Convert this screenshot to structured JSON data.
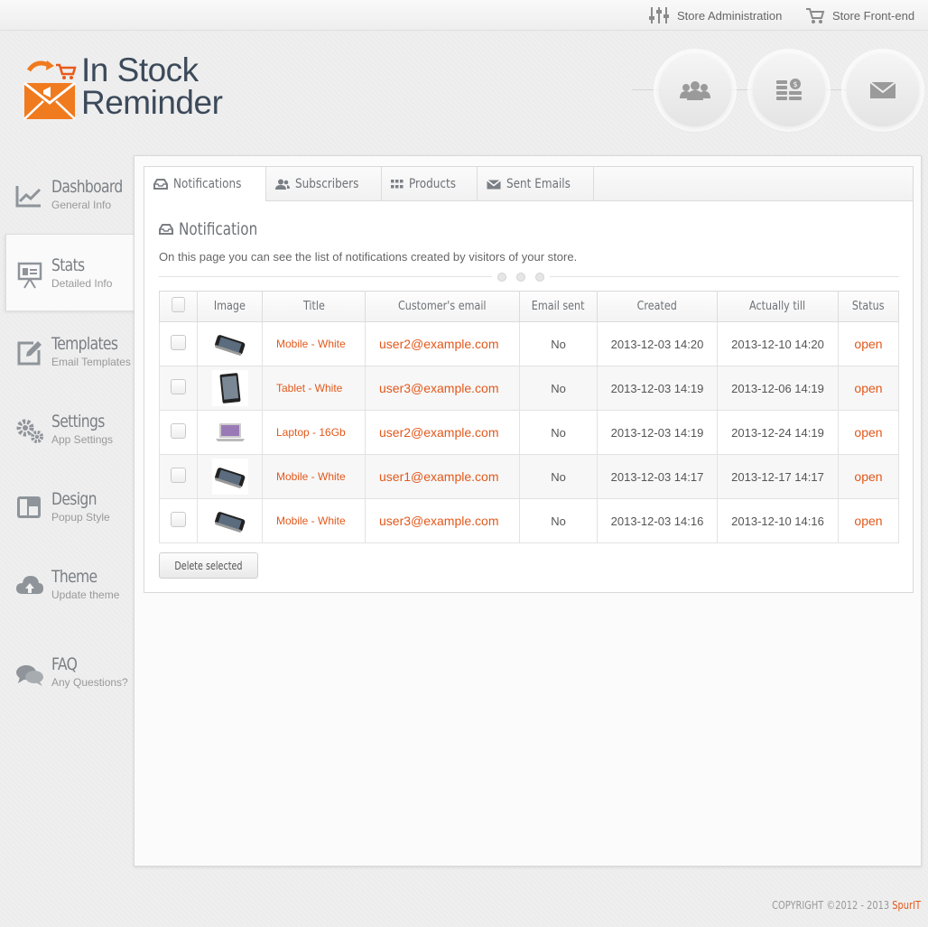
{
  "topbar": {
    "store_admin": "Store Administration",
    "store_front": "Store Front-end"
  },
  "logo": {
    "line1": "In Stock",
    "line2": "Reminder"
  },
  "header_buttons": [
    {
      "icon": "users-icon"
    },
    {
      "icon": "coins-icon"
    },
    {
      "icon": "envelope-icon"
    }
  ],
  "sidebar": {
    "items": [
      {
        "title": "Dashboard",
        "sub": "General Info",
        "icon": "chart-icon"
      },
      {
        "title": "Stats",
        "sub": "Detailed Info",
        "icon": "presentation-icon",
        "active": true
      },
      {
        "title": "Templates",
        "sub": "Email Templates",
        "icon": "edit-icon"
      },
      {
        "title": "Settings",
        "sub": "App Settings",
        "icon": "gears-icon"
      },
      {
        "title": "Design",
        "sub": "Popup Style",
        "icon": "layout-icon"
      },
      {
        "title": "Theme",
        "sub": "Update theme",
        "icon": "cloud-upload-icon"
      },
      {
        "title": "FAQ",
        "sub": "Any Questions?",
        "icon": "chat-icon"
      }
    ]
  },
  "tabs": [
    {
      "label": "Notifications",
      "icon": "inbox-icon",
      "active": true
    },
    {
      "label": "Subscribers",
      "icon": "users-icon"
    },
    {
      "label": "Products",
      "icon": "grid-icon"
    },
    {
      "label": "Sent Emails",
      "icon": "envelope-icon"
    }
  ],
  "section": {
    "title": "Notification",
    "description": "On this page you can see the list of notifications created by visitors of your store."
  },
  "table": {
    "headers": [
      "Image",
      "Title",
      "Customer's email",
      "Email sent",
      "Created",
      "Actually till",
      "Status"
    ],
    "rows": [
      {
        "product": "phone",
        "title": "Mobile - White",
        "email": "user2@example.com",
        "sent": "No",
        "created": "2013-12-03 14:20",
        "till": "2013-12-10 14:20",
        "status": "open"
      },
      {
        "product": "tablet",
        "title": "Tablet - White",
        "email": "user3@example.com",
        "sent": "No",
        "created": "2013-12-03 14:19",
        "till": "2013-12-06 14:19",
        "status": "open"
      },
      {
        "product": "laptop",
        "title": "Laptop - 16Gb",
        "email": "user2@example.com",
        "sent": "No",
        "created": "2013-12-03 14:19",
        "till": "2013-12-24 14:19",
        "status": "open"
      },
      {
        "product": "phone",
        "title": "Mobile - White",
        "email": "user1@example.com",
        "sent": "No",
        "created": "2013-12-03 14:17",
        "till": "2013-12-17 14:17",
        "status": "open"
      },
      {
        "product": "phone",
        "title": "Mobile - White",
        "email": "user3@example.com",
        "sent": "No",
        "created": "2013-12-03 14:16",
        "till": "2013-12-10 14:16",
        "status": "open"
      }
    ]
  },
  "actions": {
    "delete_selected": "Delete selected"
  },
  "footer": {
    "copyright": "COPYRIGHT ©2012 - 2013",
    "brand": "SpurIT"
  },
  "colors": {
    "accent": "#e2581b",
    "text": "#6d7277"
  }
}
